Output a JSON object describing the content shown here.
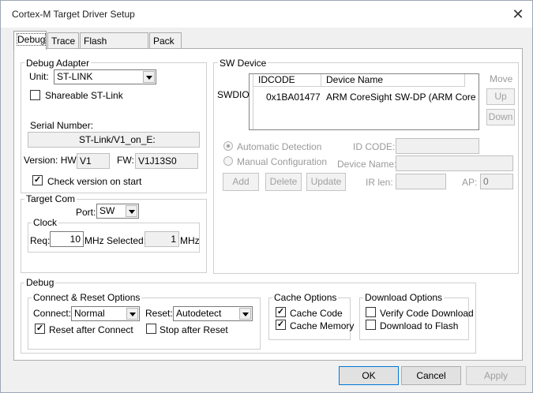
{
  "window": {
    "title": "Cortex-M Target Driver Setup",
    "close_glyph": "✕"
  },
  "tabs": [
    {
      "label": "Debug",
      "active": true
    },
    {
      "label": "Trace"
    },
    {
      "label": "Flash Download"
    },
    {
      "label": "Pack"
    }
  ],
  "debug_adapter": {
    "group_label": "Debug Adapter",
    "unit_label": "Unit:",
    "unit_value": "ST-LINK",
    "shareable_label": "Shareable ST-Link",
    "shareable_checked": false,
    "serial_label": "Serial Number:",
    "serial_value": "ST-Link/V1_on_E:",
    "version_label": "Version: HW:",
    "hw_value": "V1",
    "fw_label": "FW:",
    "fw_value": "V1J13S0",
    "check_version_label": "Check version on start",
    "check_version_checked": true,
    "check_mark": "✓"
  },
  "target_com": {
    "group_label": "Target Com",
    "port_label": "Port:",
    "port_value": "SW",
    "clock": {
      "group_label": "Clock",
      "req_label": "Req:",
      "req_value": "10",
      "req_unit": "MHz",
      "selected_label": "Selected:",
      "selected_value": "1",
      "selected_unit": "MHz"
    }
  },
  "sw_device": {
    "group_label": "SW Device",
    "row_label": "SWDIO",
    "columns": [
      "IDCODE",
      "Device Name"
    ],
    "rows": [
      {
        "idcode": "0x1BA01477",
        "device_name": "ARM CoreSight SW-DP (ARM Core"
      }
    ],
    "move_label": "Move",
    "up_label": "Up",
    "down_label": "Down",
    "auto_detect_label": "Automatic Detection",
    "manual_config_label": "Manual Configuration",
    "id_code_label": "ID CODE:",
    "device_name_label": "Device Name:",
    "add_label": "Add",
    "delete_label": "Delete",
    "update_label": "Update",
    "ir_len_label": "IR len:",
    "ap_label": "AP:",
    "ap_value": "0"
  },
  "debug": {
    "group_label": "Debug",
    "connect_reset": {
      "group_label": "Connect & Reset Options",
      "connect_label": "Connect:",
      "connect_value": "Normal",
      "reset_label": "Reset:",
      "reset_value": "Autodetect",
      "reset_after_connect_label": "Reset after Connect",
      "reset_after_connect_checked": true,
      "stop_after_reset_label": "Stop after Reset",
      "stop_after_reset_checked": false
    },
    "cache": {
      "group_label": "Cache Options",
      "cache_code_label": "Cache Code",
      "cache_memory_label": "Cache Memory"
    },
    "download": {
      "group_label": "Download Options",
      "verify_label": "Verify Code Download",
      "flash_label": "Download to Flash"
    }
  },
  "buttons": {
    "ok": "OK",
    "cancel": "Cancel",
    "apply": "Apply"
  }
}
